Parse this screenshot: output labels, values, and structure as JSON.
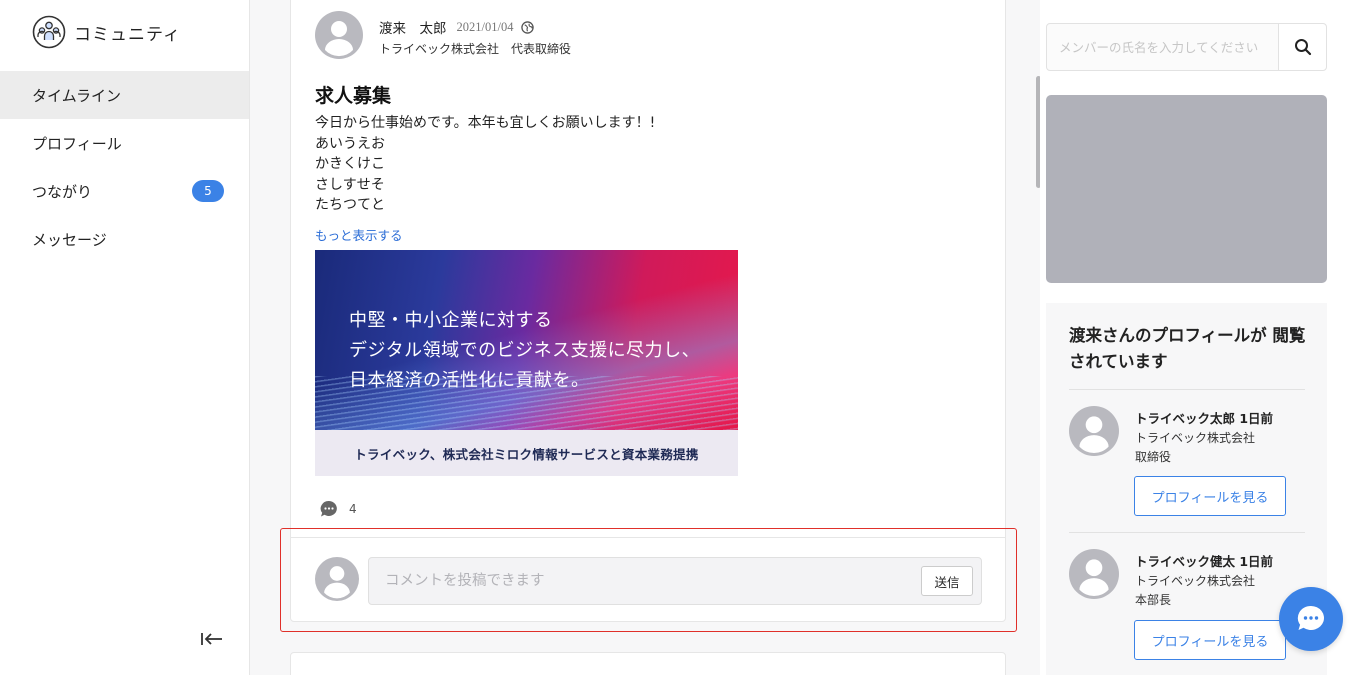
{
  "sidebar": {
    "brand_title": "コミュニティ",
    "items": [
      {
        "label": "タイムライン",
        "active": true
      },
      {
        "label": "プロフィール"
      },
      {
        "label": "つながり",
        "badge": "5"
      },
      {
        "label": "メッセージ"
      }
    ]
  },
  "post": {
    "author": "渡来　太郎",
    "date": "2021/01/04",
    "company": "トライベック株式会社　代表取締役",
    "title": "求人募集",
    "body_lines": [
      "今日から仕事始めです。本年も宜しくお願いします！!",
      "あいうえお",
      "かきくけこ",
      "さしすせそ",
      "たちつてと"
    ],
    "more_link": "もっと表示する",
    "banner": {
      "lines": [
        "中堅・中小企業に対する",
        "デジタル領域でのビジネス支援に尽力し、",
        "日本経済の活性化に貢献を。"
      ],
      "caption": "トライベック、株式会社ミロク情報サービスと資本業務提携"
    },
    "comment_count": "4",
    "comment_placeholder": "コメントを投稿できます",
    "send_label": "送信"
  },
  "right": {
    "search_placeholder": "メンバーの氏名を入力してください",
    "viewers_title": "渡来さんのプロフィールが 閲覧されています",
    "viewers": [
      {
        "name": "トライベック太郎 1日前",
        "company": "トライベック株式会社",
        "role": "取締役",
        "button": "プロフィールを見る"
      },
      {
        "name": "トライベック健太 1日前",
        "company": "トライベック株式会社",
        "role": "本部長",
        "button": "プロフィールを見る"
      }
    ]
  },
  "colors": {
    "accent": "#3b82e6",
    "highlight": "#e0302a",
    "ad_placeholder": "#b0b1b9"
  },
  "icons": [
    "community-icon",
    "collapse-sidebar-icon",
    "globe-icon",
    "comment-icon",
    "search-icon",
    "chat-icon"
  ]
}
